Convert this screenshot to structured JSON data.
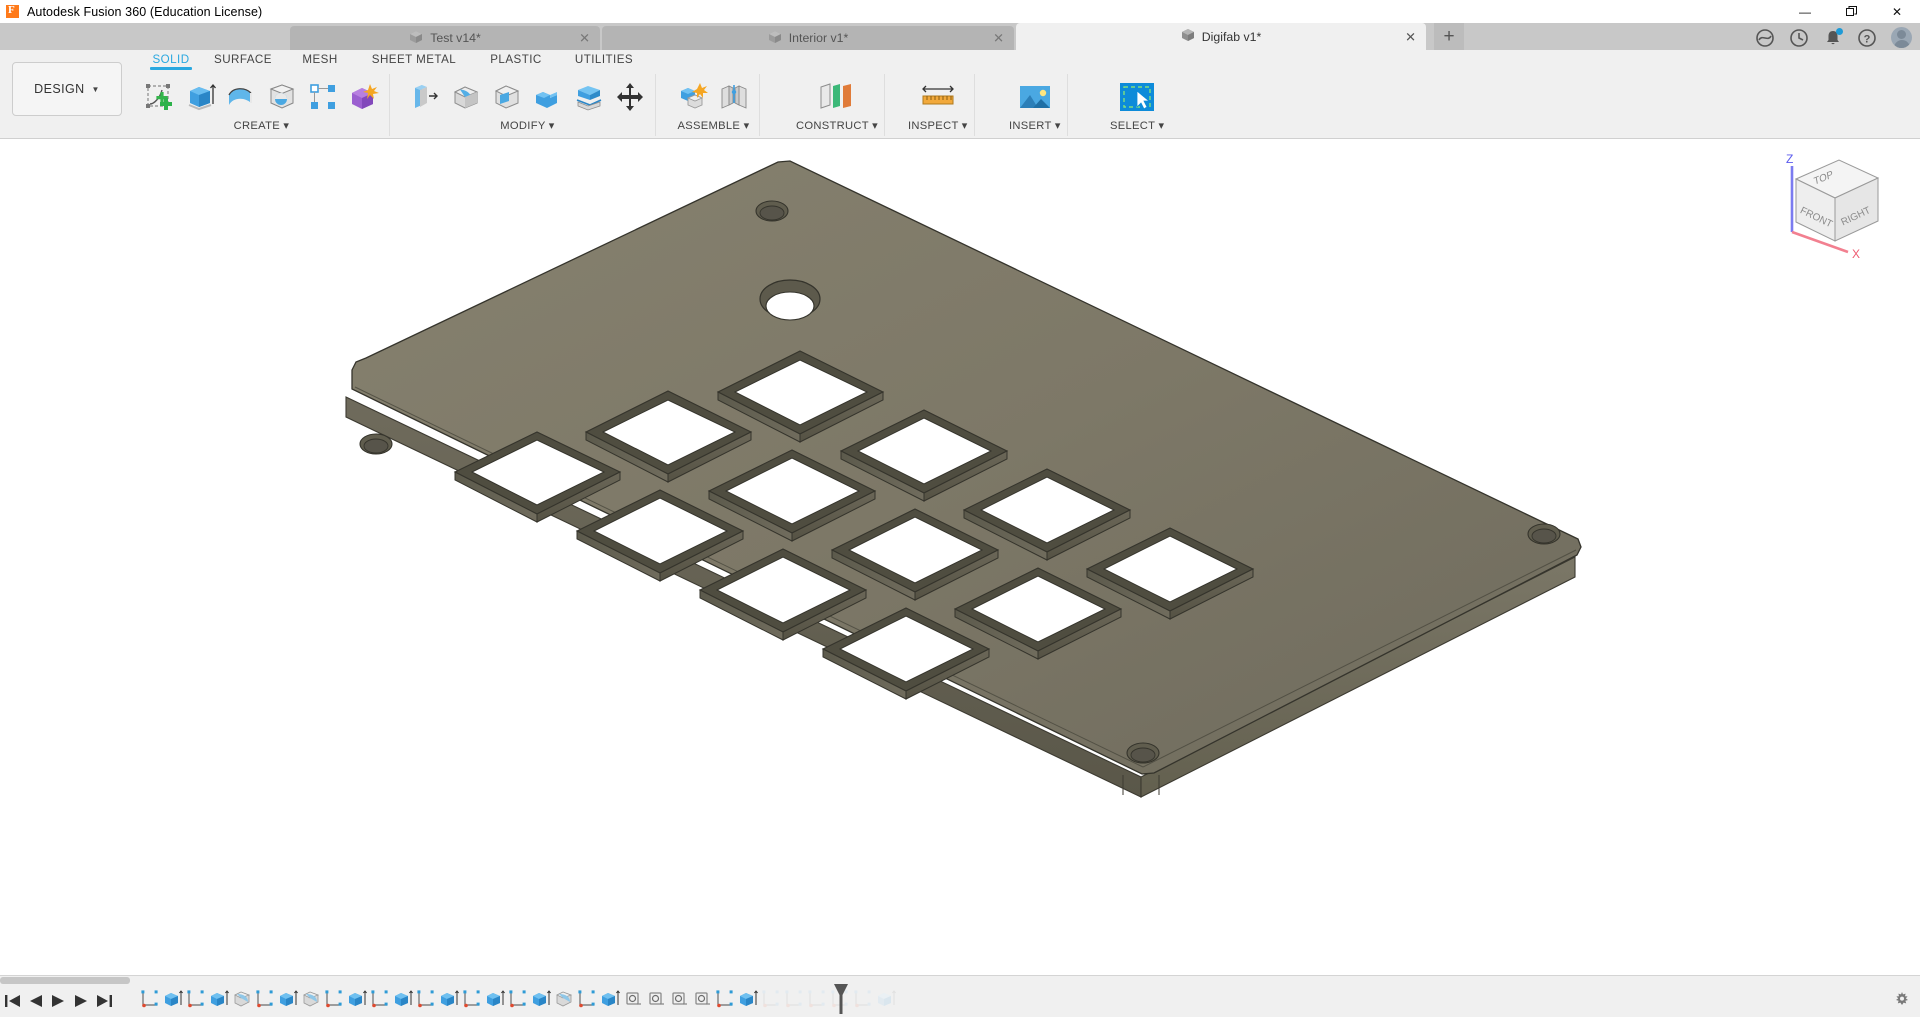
{
  "window": {
    "title": "Autodesk Fusion 360 (Education License)",
    "app_icon": "fusion-logo-icon",
    "controls": {
      "minimize": "—",
      "maximize": "❐",
      "close": "✕"
    }
  },
  "quick_access": {
    "items": [
      {
        "name": "grid-apps-icon",
        "label": ""
      },
      {
        "name": "new-file-icon",
        "label": ""
      },
      {
        "name": "save-icon",
        "label": ""
      },
      {
        "name": "undo-icon",
        "label": ""
      },
      {
        "name": "redo-icon",
        "label": ""
      }
    ]
  },
  "tabs": {
    "items": [
      {
        "label": "Test v14*",
        "active": false,
        "closable": true
      },
      {
        "label": "Interior v1*",
        "active": false,
        "closable": true
      },
      {
        "label": "Digifab v1*",
        "active": true,
        "closable": true
      }
    ],
    "new_tab_label": "+",
    "right_tools": [
      {
        "name": "extensions-icon",
        "label": ""
      },
      {
        "name": "job-status-icon",
        "label": ""
      },
      {
        "name": "notifications-bell-icon",
        "label": "",
        "badge": true
      },
      {
        "name": "help-icon",
        "label": ""
      },
      {
        "name": "account-avatar",
        "label": ""
      }
    ]
  },
  "ribbon": {
    "design_button": "DESIGN",
    "workspace_tabs": [
      {
        "label": "SOLID",
        "active": true
      },
      {
        "label": "SURFACE",
        "active": false
      },
      {
        "label": "MESH",
        "active": false
      },
      {
        "label": "SHEET METAL",
        "active": false
      },
      {
        "label": "PLASTIC",
        "active": false
      },
      {
        "label": "UTILITIES",
        "active": false
      }
    ],
    "groups": [
      {
        "label": "CREATE ▾",
        "icons": [
          "create-sketch-icon",
          "extrude-icon",
          "revolve-icon",
          "sphere-icon",
          "pattern-icon",
          "combine-icon"
        ]
      },
      {
        "label": "MODIFY ▾",
        "icons": [
          "press-pull-icon",
          "fillet-icon",
          "shell-icon",
          "combine-bodies-icon",
          "split-face-icon",
          "move-copy-icon"
        ]
      },
      {
        "label": "ASSEMBLE ▾",
        "icons": [
          "new-component-icon",
          "joint-icon"
        ]
      },
      {
        "label": "CONSTRUCT ▾",
        "icons": [
          "offset-plane-icon"
        ]
      },
      {
        "label": "INSPECT ▾",
        "icons": [
          "measure-icon"
        ]
      },
      {
        "label": "INSERT ▾",
        "icons": [
          "insert-image-icon"
        ]
      },
      {
        "label": "SELECT ▾",
        "icons": [
          "select-cursor-icon"
        ]
      }
    ]
  },
  "viewcube": {
    "faces": {
      "top": "TOP",
      "front": "FRONT",
      "right": "RIGHT"
    },
    "axes": {
      "z": "Z",
      "x": "X"
    },
    "axis_colors": {
      "z": "#6a6aff",
      "x": "#ff6a7a"
    }
  },
  "canvas": {
    "background": "#ffffff",
    "model": {
      "name": "keyboard-switch-plate",
      "material_color": "#79756a",
      "top_face_color": "#7c7869",
      "edge_color": "#3a382f",
      "cutout_count": 12,
      "screw_hole_count": 4,
      "large_hole_count": 1,
      "description": "Isometric view of a rectangular keyboard switch plate with twelve square cutouts, four corner screw holes and one larger circular hole"
    }
  },
  "timeline": {
    "nav_buttons": [
      "go-to-beginning-icon",
      "step-back-icon",
      "play-icon",
      "step-forward-icon",
      "go-to-end-icon"
    ],
    "features": [
      {
        "type": "sketch",
        "done": true
      },
      {
        "type": "extrude",
        "done": true
      },
      {
        "type": "sketch",
        "done": true
      },
      {
        "type": "extrude",
        "done": true
      },
      {
        "type": "fillet",
        "done": true
      },
      {
        "type": "sketch",
        "done": true
      },
      {
        "type": "extrude",
        "done": true
      },
      {
        "type": "fillet",
        "done": true
      },
      {
        "type": "sketch",
        "done": true
      },
      {
        "type": "extrude",
        "done": true
      },
      {
        "type": "sketch",
        "done": true
      },
      {
        "type": "extrude",
        "done": true
      },
      {
        "type": "sketch",
        "done": true
      },
      {
        "type": "extrude",
        "done": true
      },
      {
        "type": "sketch",
        "done": true
      },
      {
        "type": "extrude",
        "done": true
      },
      {
        "type": "sketch",
        "done": true
      },
      {
        "type": "extrude",
        "done": true
      },
      {
        "type": "fillet",
        "done": true
      },
      {
        "type": "sketch",
        "done": true
      },
      {
        "type": "extrude",
        "done": true
      },
      {
        "type": "hole",
        "done": true
      },
      {
        "type": "hole",
        "done": true
      },
      {
        "type": "hole",
        "done": true
      },
      {
        "type": "hole",
        "done": true
      },
      {
        "type": "sketch",
        "done": true
      },
      {
        "type": "extrude",
        "done": true
      },
      {
        "type": "sketch",
        "done": false
      },
      {
        "type": "sketch",
        "done": false
      },
      {
        "type": "sketch",
        "done": false
      },
      {
        "type": "sketch",
        "done": false
      },
      {
        "type": "sketch",
        "done": false
      },
      {
        "type": "extrude",
        "done": false
      }
    ],
    "marker_position_index": 27,
    "settings_icon": "timeline-settings-icon"
  }
}
